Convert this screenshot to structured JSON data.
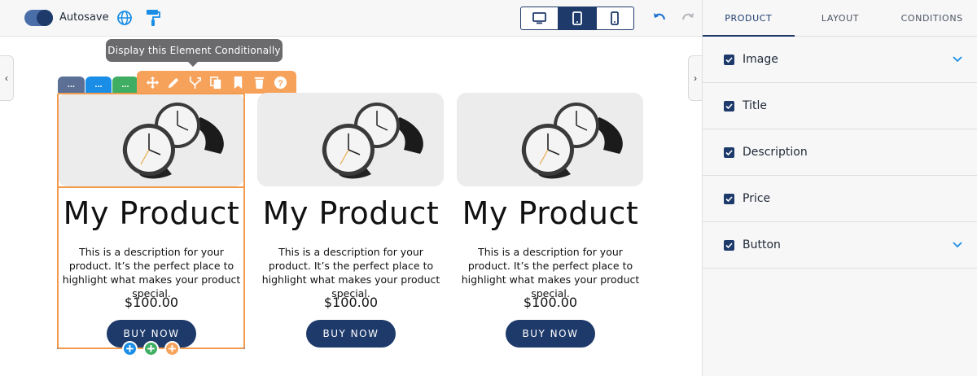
{
  "toolbar": {
    "autosave_label": "Autosave",
    "autosave_on": true,
    "devices": [
      {
        "name": "desktop",
        "active": false
      },
      {
        "name": "tablet",
        "active": true
      },
      {
        "name": "mobile",
        "active": false
      }
    ],
    "accent_color": "#1e3a6b"
  },
  "tooltip": {
    "text": "Display this Element Conditionally"
  },
  "tags": [
    "...",
    "...",
    "..."
  ],
  "action_icons": [
    "move-icon",
    "edit-icon",
    "conditional-icon",
    "copy-icon",
    "bookmark-icon",
    "delete-icon",
    "help-icon"
  ],
  "products": [
    {
      "title": "My Product",
      "description": "This is a description for your product. It’s the perfect place to highlight what makes your product special.",
      "price": "$100.00",
      "button": "BUY NOW"
    },
    {
      "title": "My Product",
      "description": "This is a description for your product. It’s the perfect place to highlight what makes your product special.",
      "price": "$100.00",
      "button": "BUY NOW"
    },
    {
      "title": "My Product",
      "description": "This is a description for your product. It’s the perfect place to highlight what makes your product special.",
      "price": "$100.00",
      "button": "BUY NOW"
    }
  ],
  "add_buttons": [
    "+",
    "+",
    "+"
  ],
  "panel": {
    "tabs": [
      {
        "label": "PRODUCT",
        "active": true
      },
      {
        "label": "LAYOUT",
        "active": false
      },
      {
        "label": "CONDITIONS",
        "active": false
      }
    ],
    "rows": [
      {
        "label": "Image",
        "checked": true,
        "expandable": true
      },
      {
        "label": "Title",
        "checked": true,
        "expandable": false
      },
      {
        "label": "Description",
        "checked": true,
        "expandable": false
      },
      {
        "label": "Price",
        "checked": true,
        "expandable": false
      },
      {
        "label": "Button",
        "checked": true,
        "expandable": true
      }
    ]
  }
}
